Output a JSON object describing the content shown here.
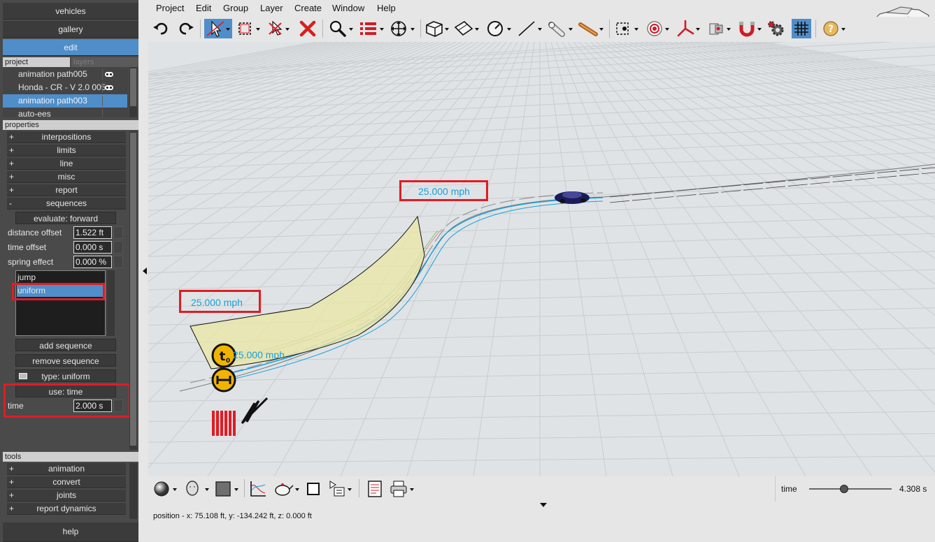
{
  "nav": {
    "vehicles": "vehicles",
    "gallery": "gallery",
    "edit": "edit",
    "help": "help"
  },
  "project_tabs": {
    "project": "project",
    "layers": "layers"
  },
  "project_items": [
    {
      "label": "animation path005",
      "visible": true
    },
    {
      "label": "Honda - CR - V 2.0 005",
      "visible": true
    },
    {
      "label": "animation path003",
      "selected": true
    },
    {
      "label": "auto-ees"
    }
  ],
  "properties": {
    "header": "properties",
    "groups": [
      {
        "sign": "+",
        "label": "interpositions"
      },
      {
        "sign": "+",
        "label": "limits"
      },
      {
        "sign": "+",
        "label": "line"
      },
      {
        "sign": "+",
        "label": "misc"
      },
      {
        "sign": "+",
        "label": "report"
      },
      {
        "sign": "-",
        "label": "sequences"
      }
    ],
    "evaluate": "evaluate: forward",
    "distance_offset_label": "distance offset",
    "distance_offset_value": "1.522 ft",
    "time_offset_label": "time offset",
    "time_offset_value": "0.000 s",
    "spring_effect_label": "spring effect",
    "spring_effect_value": "0.000 %",
    "sequence_items": [
      "jump",
      "uniform"
    ],
    "add_sequence": "add sequence",
    "remove_sequence": "remove sequence",
    "type": "type: uniform",
    "use": "use: time",
    "time_label": "time",
    "time_value": "2.000 s"
  },
  "tools": {
    "header": "tools",
    "groups": [
      {
        "sign": "+",
        "label": "animation"
      },
      {
        "sign": "+",
        "label": "convert"
      },
      {
        "sign": "+",
        "label": "joints"
      },
      {
        "sign": "+",
        "label": "report dynamics"
      }
    ]
  },
  "menu": [
    "Project",
    "Edit",
    "Group",
    "Layer",
    "Create",
    "Window",
    "Help"
  ],
  "viewport": {
    "speed_label_1": "25.000 mph",
    "speed_label_2": "25.000 mph",
    "speed_label_3": "25.000 mph"
  },
  "timeline": {
    "label": "time",
    "value": "4.308 s",
    "slider_fraction": 0.42
  },
  "status": {
    "position": "position - x: 75.108 ft, y: -134.242 ft, z: 0.000 ft"
  },
  "colors": {
    "accent": "#4f8ec9",
    "highlight": "#e01c24",
    "path": "#1aa0dc",
    "panel": "#4a4a4a"
  }
}
